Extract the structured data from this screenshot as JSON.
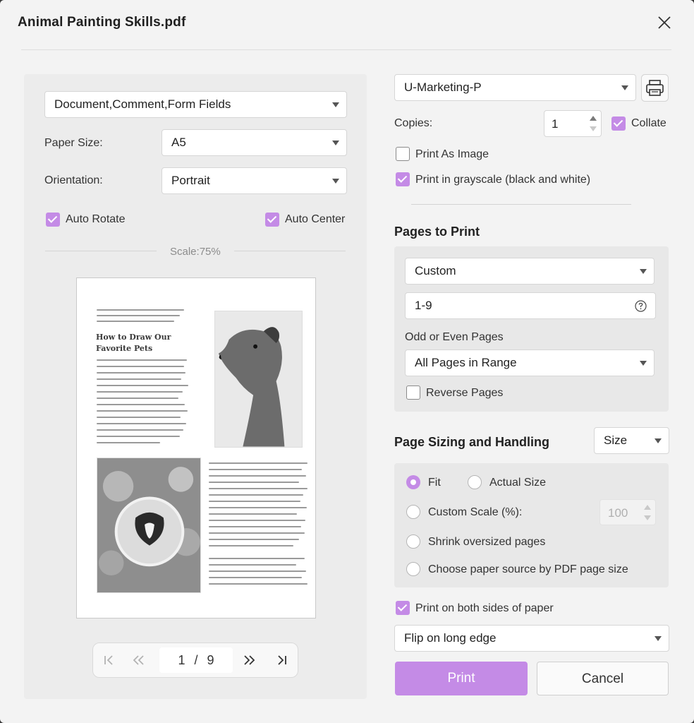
{
  "dialog": {
    "title": "Animal Painting Skills.pdf",
    "close_icon": "close-icon"
  },
  "left": {
    "content_select": "Document,Comment,Form Fields",
    "paper_size_label": "Paper Size:",
    "paper_size_value": "A5",
    "orientation_label": "Orientation:",
    "orientation_value": "Portrait",
    "auto_rotate_label": "Auto Rotate",
    "auto_rotate_checked": true,
    "auto_center_label": "Auto Center",
    "auto_center_checked": true,
    "scale_label": "Scale:75%",
    "preview": {
      "heading_line1": "How to Draw Our",
      "heading_line2": "Favorite Pets"
    },
    "pager": {
      "current_page": "1",
      "separator": "/",
      "total_pages": "9",
      "icons": [
        "first-page-icon",
        "prev-page-icon",
        "next-page-icon",
        "last-page-icon"
      ]
    }
  },
  "right": {
    "printer_select": "U-Marketing-P",
    "printer_settings_icon": "printer-icon",
    "copies_label": "Copies:",
    "copies_value": "1",
    "collate_label": "Collate",
    "collate_checked": true,
    "print_as_image_label": "Print As Image",
    "print_as_image_checked": false,
    "grayscale_label": "Print in grayscale (black and white)",
    "grayscale_checked": true,
    "pages_to_print": {
      "title": "Pages to Print",
      "range_mode": "Custom",
      "range_value": "1-9",
      "help_icon": "help-circle-icon",
      "odd_even_label": "Odd or Even Pages",
      "odd_even_value": "All Pages in Range",
      "reverse_label": "Reverse Pages",
      "reverse_checked": false
    },
    "sizing": {
      "title": "Page Sizing and Handling",
      "mode_select": "Size",
      "fit_label": "Fit",
      "actual_size_label": "Actual Size",
      "custom_scale_label": "Custom Scale (%):",
      "custom_scale_value": "100",
      "shrink_label": "Shrink oversized pages",
      "paper_source_label": "Choose paper source by PDF page size",
      "selected": "Fit"
    },
    "duplex_label": "Print on both sides of paper",
    "duplex_checked": true,
    "flip_select": "Flip on long edge",
    "print_button": "Print",
    "cancel_button": "Cancel"
  },
  "colors": {
    "accent": "#c48be6",
    "dialog_bg": "#f3f3f3",
    "panel_bg": "#ececec"
  }
}
